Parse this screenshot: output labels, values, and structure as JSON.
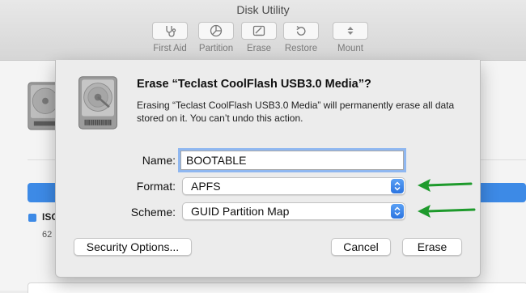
{
  "window": {
    "title": "Disk Utility"
  },
  "toolbar": {
    "buttons": [
      {
        "label": "First Aid",
        "icon": "stethoscope-icon"
      },
      {
        "label": "Partition",
        "icon": "pie-chart-icon"
      },
      {
        "label": "Erase",
        "icon": "eraser-icon"
      },
      {
        "label": "Restore",
        "icon": "restore-icon"
      },
      {
        "label": "Mount",
        "icon": "mount-icon"
      }
    ]
  },
  "background": {
    "legend_label": "ISO",
    "legend_size": "62"
  },
  "dialog": {
    "title": "Erase “Teclast CoolFlash USB3.0 Media”?",
    "message": "Erasing “Teclast CoolFlash USB3.0 Media” will permanently erase all data stored on it. You can’t undo this action.",
    "name_label": "Name:",
    "name_value": "BOOTABLE",
    "format_label": "Format:",
    "format_value": "APFS",
    "scheme_label": "Scheme:",
    "scheme_value": "GUID Partition Map",
    "security_button": "Security Options...",
    "cancel_button": "Cancel",
    "erase_button": "Erase"
  },
  "colors": {
    "accent": "#3d8ae6",
    "annotation_arrow": "#1e9a2c"
  }
}
